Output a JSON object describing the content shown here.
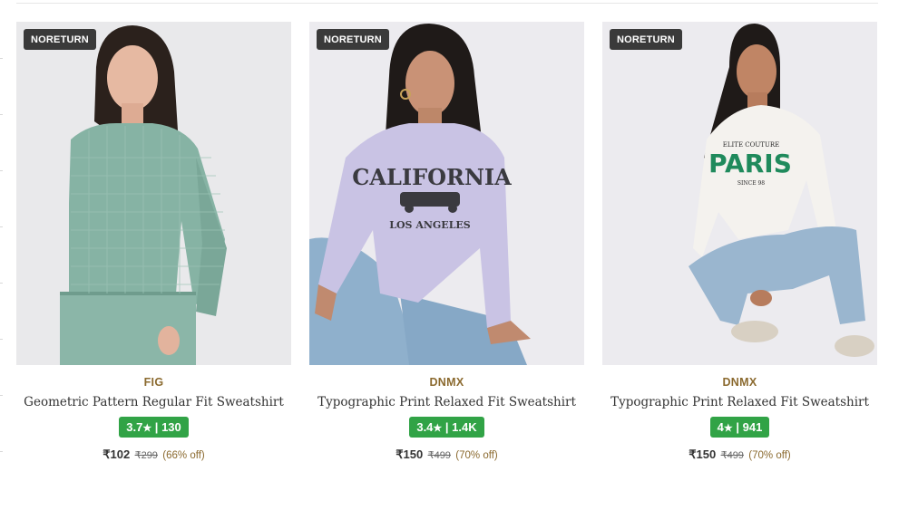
{
  "products": [
    {
      "badge": "NORETURN",
      "brand": "FIG",
      "name": "Geometric Pattern Regular Fit Sweatshirt",
      "rating": "3.7",
      "rating_count": "130",
      "price": "₹102",
      "mrp": "₹299",
      "discount": "(66% off)",
      "colors": {
        "background": "#e9e9eb",
        "garment": "#86b3a4"
      }
    },
    {
      "badge": "NORETURN",
      "brand": "DNMX",
      "name": "Typographic Print Relaxed Fit Sweatshirt",
      "rating": "3.4",
      "rating_count": "1.4K",
      "price": "₹150",
      "mrp": "₹499",
      "discount": "(70% off)",
      "print_text": "CALIFORNIA",
      "print_subtext": "LOS ANGELES",
      "colors": {
        "background": "#ecebef",
        "garment": "#c9c3e4"
      }
    },
    {
      "badge": "NORETURN",
      "brand": "DNMX",
      "name": "Typographic Print Relaxed Fit Sweatshirt",
      "rating": "4",
      "rating_count": "941",
      "price": "₹150",
      "mrp": "₹499",
      "discount": "(70% off)",
      "print_text": "PARIS",
      "print_subtext": "ELITE COUTURE",
      "print_footer": "SINCE 98",
      "colors": {
        "background": "#ecebef",
        "garment": "#f4f2ee"
      }
    }
  ],
  "colors": {
    "rating_green": "#31a346",
    "brand_gold": "#8b6a2f"
  },
  "icons": {
    "rating": "star-icon"
  }
}
